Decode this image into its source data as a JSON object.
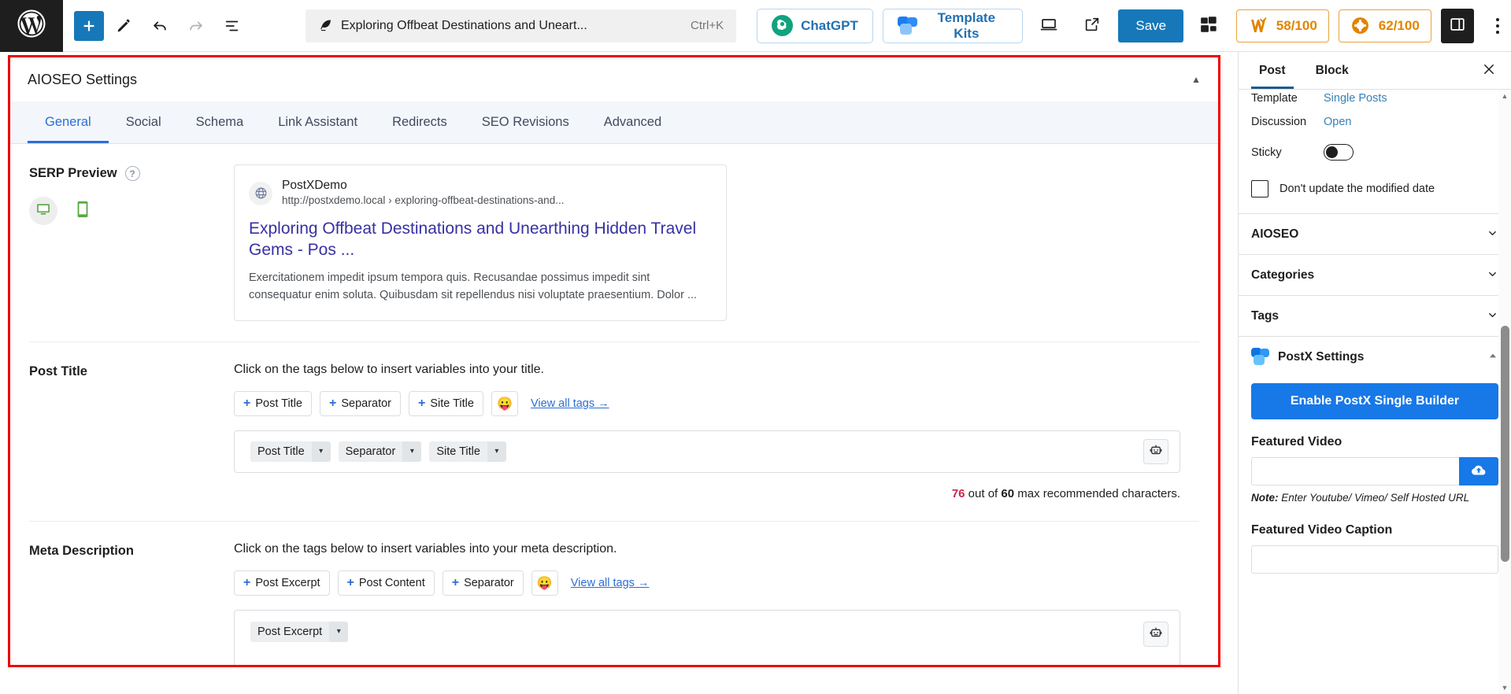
{
  "toolbar": {
    "logo_icon": "wordpress-logo",
    "add_block_label": "+",
    "tools": [
      {
        "name": "edit-tool",
        "icon": "pencil-icon"
      },
      {
        "name": "undo-button",
        "icon": "undo-arrow-icon"
      },
      {
        "name": "redo-button",
        "icon": "redo-arrow-icon"
      },
      {
        "name": "document-overview-button",
        "icon": "list-view-icon"
      }
    ],
    "document_bar": {
      "icon": "feather-icon",
      "title": "Exploring Offbeat Destinations and Uneart...",
      "shortcut": "Ctrl+K"
    },
    "chatgpt_label": "ChatGPT",
    "template_kits_label": "Template Kits",
    "view_icon": "desktop-preview-icon",
    "external_link_icon": "external-link-icon",
    "save_label": "Save",
    "blocks_icon": "blocks-stack-icon",
    "seo_score": "58/100",
    "readability_score": "62/100",
    "sidebar_toggle_icon": "settings-panel-icon",
    "more_options_icon": "kebab-menu-icon"
  },
  "aioseo": {
    "panel_title": "AIOSEO Settings",
    "collapse_icon": "chevron-up-icon",
    "tabs": [
      {
        "label": "General",
        "active": true
      },
      {
        "label": "Social",
        "active": false
      },
      {
        "label": "Schema",
        "active": false
      },
      {
        "label": "Link Assistant",
        "active": false
      },
      {
        "label": "Redirects",
        "active": false
      },
      {
        "label": "SEO Revisions",
        "active": false
      },
      {
        "label": "Advanced",
        "active": false
      }
    ],
    "serp": {
      "label": "SERP Preview",
      "help_icon": "question-mark-icon",
      "desktop_icon": "desktop-icon",
      "mobile_icon": "mobile-icon",
      "active_device": "desktop",
      "favicon_icon": "globe-icon",
      "site_name": "PostXDemo",
      "url": "http://postxdemo.local › exploring-offbeat-destinations-and...",
      "title": "Exploring Offbeat Destinations and Unearthing Hidden Travel Gems - Pos ...",
      "description": "Exercitationem impedit ipsum tempora quis. Recusandae possimus impedit sint consequatur enim soluta. Quibusdam sit repellendus nisi voluptate praesentium. Dolor ..."
    },
    "post_title": {
      "label": "Post Title",
      "hint": "Click on the tags below to insert variables into your title.",
      "tags": [
        "Post Title",
        "Separator",
        "Site Title"
      ],
      "emoji": "😛",
      "view_all_label": "View all tags →",
      "chips": [
        "Post Title",
        "Separator",
        "Site Title"
      ],
      "ai_icon": "robot-icon",
      "counter_current": "76",
      "counter_mid": " out of ",
      "counter_max": "60",
      "counter_suffix": " max recommended characters."
    },
    "meta_description": {
      "label": "Meta Description",
      "hint": "Click on the tags below to insert variables into your meta description.",
      "tags": [
        "Post Excerpt",
        "Post Content",
        "Separator"
      ],
      "emoji": "😛",
      "view_all_label": "View all tags →",
      "chips": [
        "Post Excerpt"
      ],
      "ai_icon": "robot-icon"
    }
  },
  "sidebar": {
    "tabs": [
      {
        "label": "Post",
        "active": true
      },
      {
        "label": "Block",
        "active": false
      }
    ],
    "close_icon": "close-icon",
    "properties": [
      {
        "label": "Template",
        "value": "Single Posts",
        "type": "link"
      },
      {
        "label": "Discussion",
        "value": "Open",
        "type": "link"
      },
      {
        "label": "Sticky",
        "value": "",
        "type": "toggle"
      }
    ],
    "modified_date_checkbox": {
      "label": "Don't update the modified date",
      "checked": false
    },
    "panels": [
      {
        "label": "AIOSEO",
        "expanded": false,
        "icon": null
      },
      {
        "label": "Categories",
        "expanded": false,
        "icon": null
      },
      {
        "label": "Tags",
        "expanded": false,
        "icon": null
      },
      {
        "label": "PostX Settings",
        "expanded": true,
        "icon": "postx-logo-icon"
      }
    ],
    "postx": {
      "enable_button_label": "Enable PostX Single Builder",
      "featured_video_label": "Featured Video",
      "featured_video_value": "",
      "upload_icon": "cloud-upload-icon",
      "note_prefix": "Note:",
      "note_text": " Enter Youtube/ Vimeo/ Self Hosted URL",
      "featured_video_caption_label": "Featured Video Caption",
      "featured_video_caption_value": ""
    }
  },
  "colors": {
    "wp_blue": "#1778b9",
    "accent_blue": "#2b6ed4",
    "orange": "#e28400",
    "highlight_red": "#ee0000",
    "serp_title_purple": "#3730a3"
  }
}
